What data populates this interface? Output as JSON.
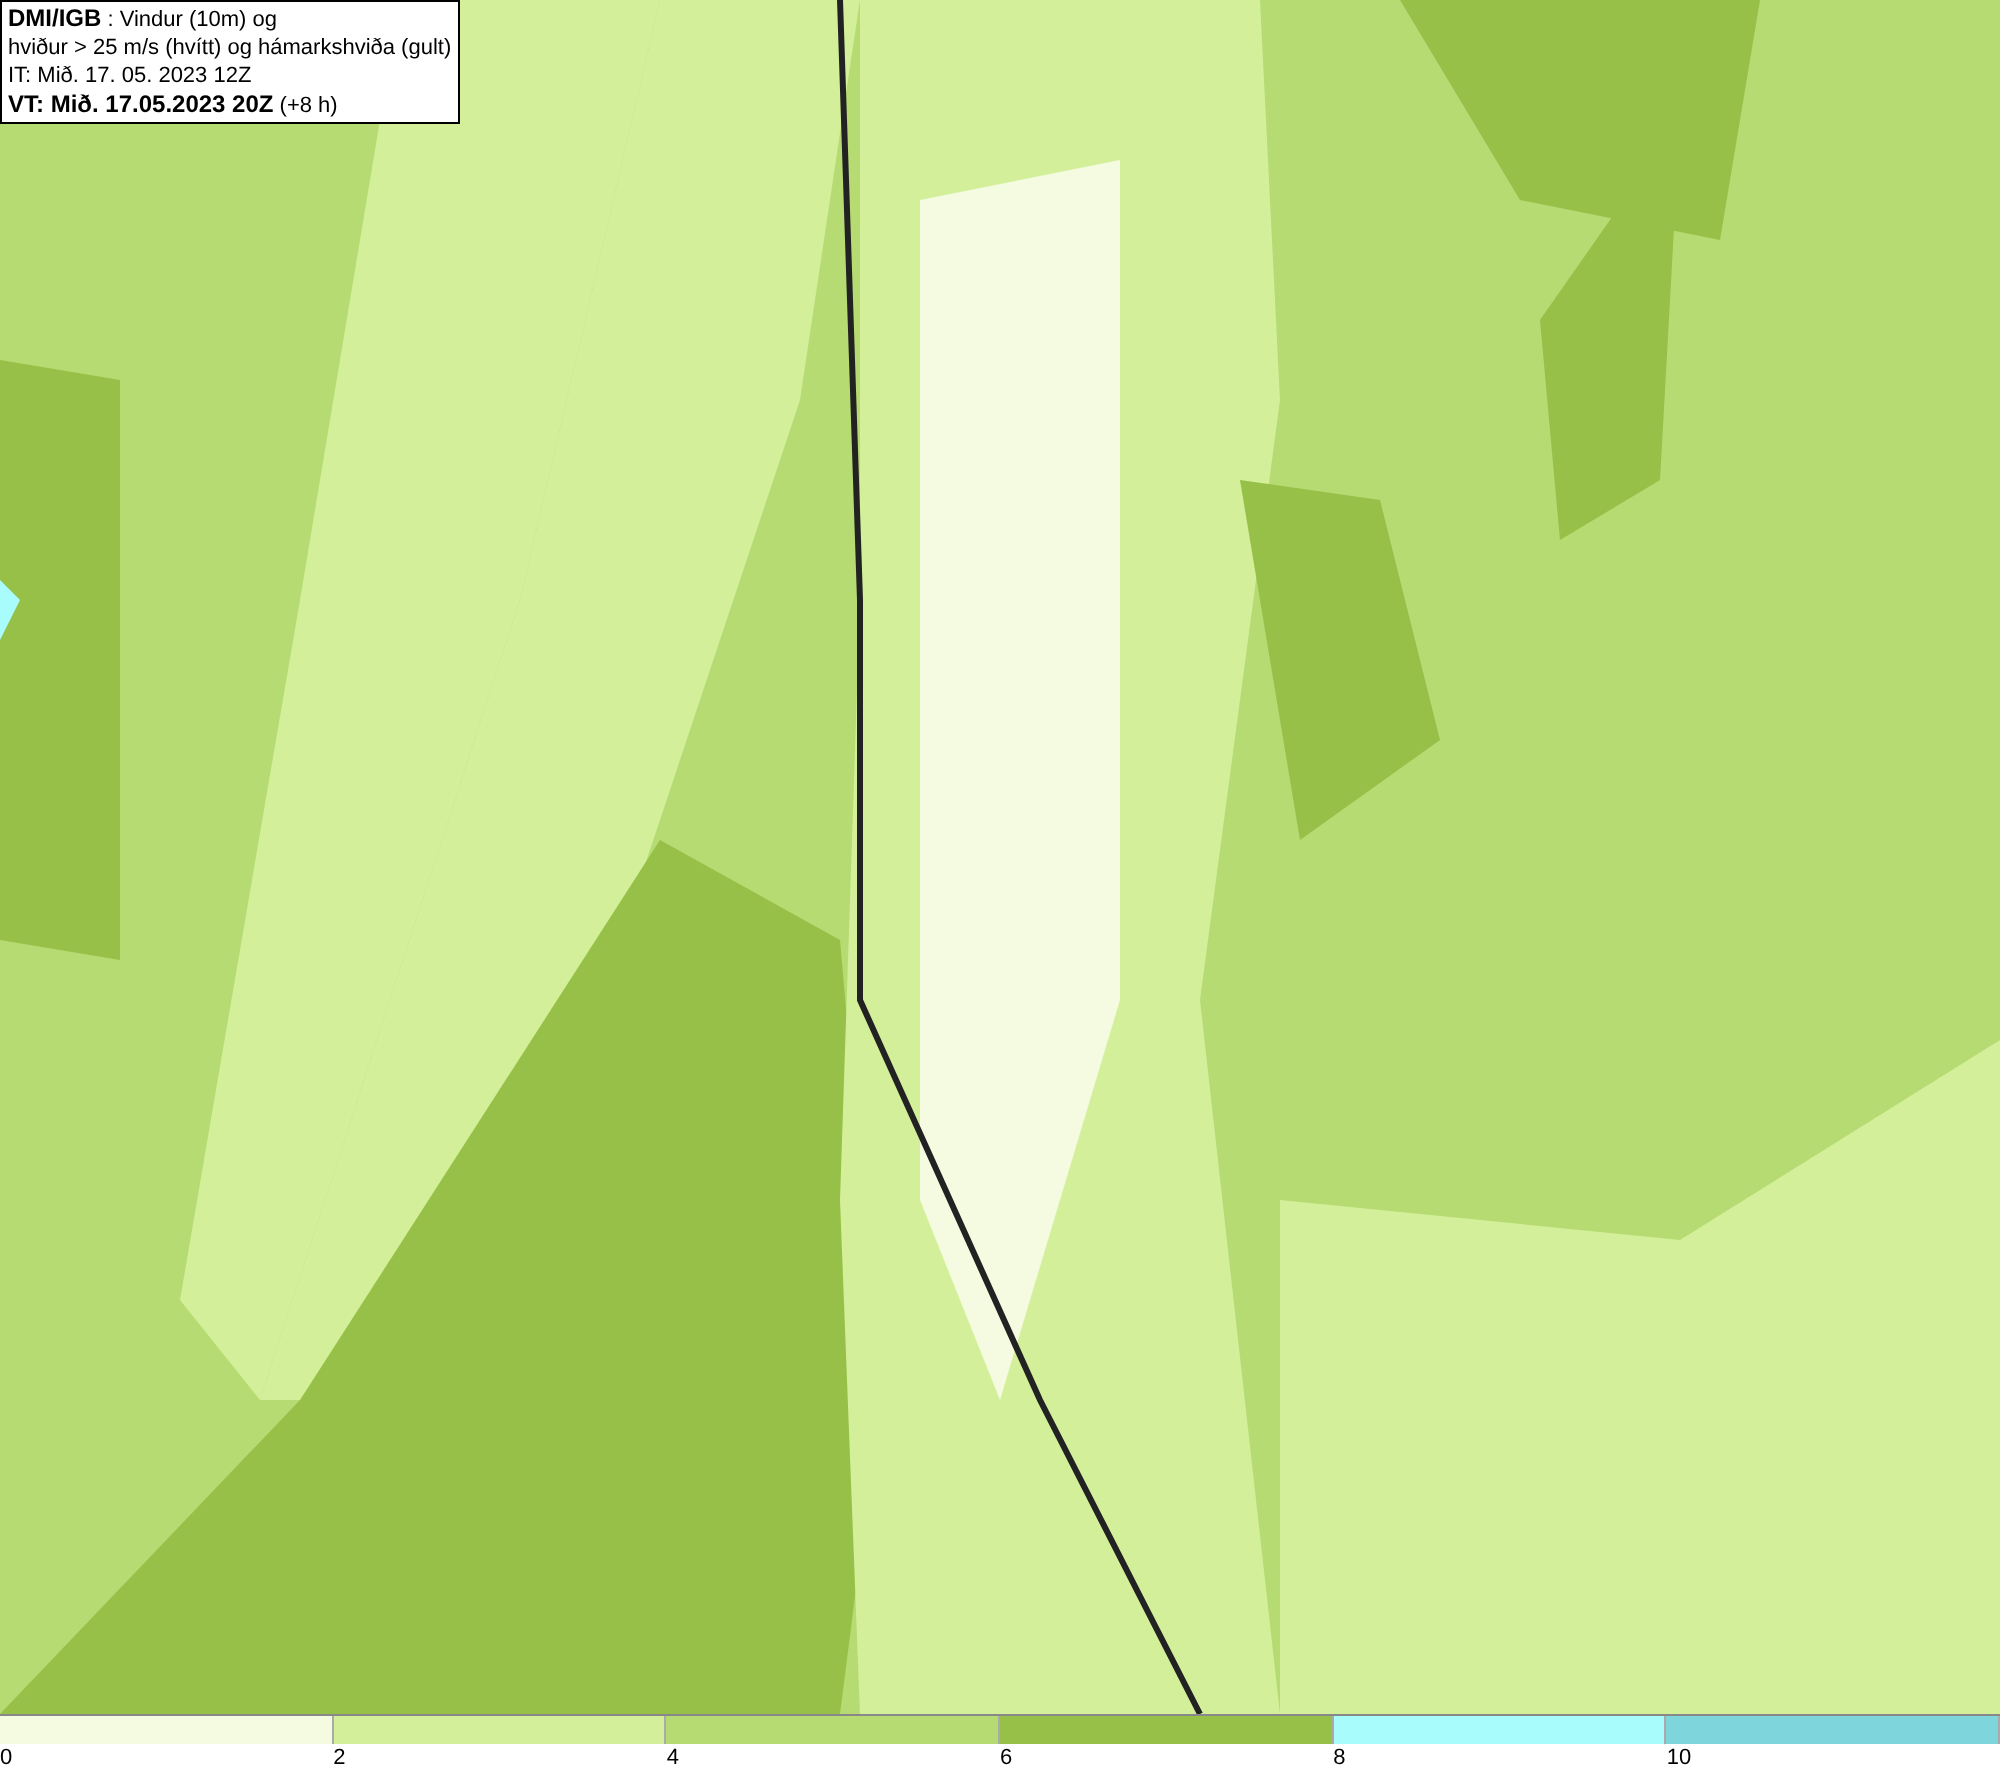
{
  "title_box": {
    "lines": [
      "**DMI/IGB** : Vindur (10m) og",
      "hviður > 25 m/s (hvítt) og hámarkshviða (gult)",
      "IT: Mið. 17. 05. 2023 12Z",
      "**VT: Mið. 17.05.2023 20Z** (+8 h)"
    ]
  },
  "legend": {
    "swatches": [
      {
        "color": "#f5fbe0"
      },
      {
        "color": "#d4ef9a"
      },
      {
        "color": "#b5db72"
      },
      {
        "color": "#96c048"
      },
      {
        "color": "#a8fcfc"
      },
      {
        "color": "#7ed6dc"
      }
    ],
    "tick_labels": [
      "0",
      "2",
      "4",
      "6",
      "8",
      "10"
    ]
  }
}
